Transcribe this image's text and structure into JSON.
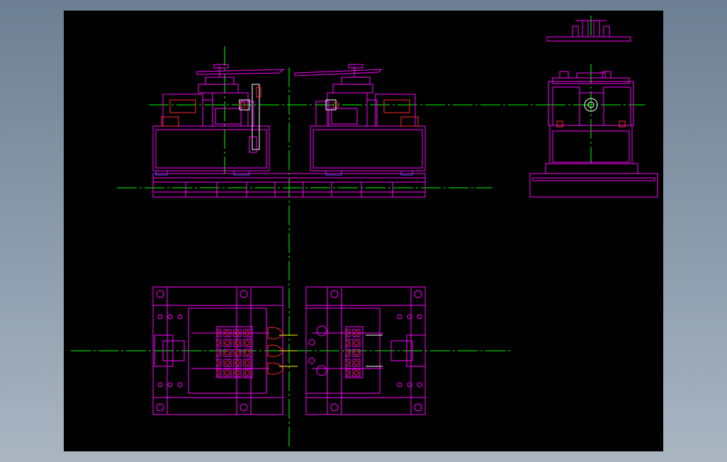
{
  "viewer": {
    "background": "#000000",
    "frame_colors": [
      "#6d7f92",
      "#aab5c1"
    ]
  },
  "drawing": {
    "line_colors": {
      "outline": "#ff00ff",
      "center_line": "#00ff00",
      "detail_red": "#ff2a2a",
      "detail_blue": "#5050ff",
      "detail_white": "#ffffff",
      "detail_yellow": "#ffff00"
    },
    "views": [
      "front-view",
      "side-view",
      "top-view",
      "detail-view"
    ]
  }
}
